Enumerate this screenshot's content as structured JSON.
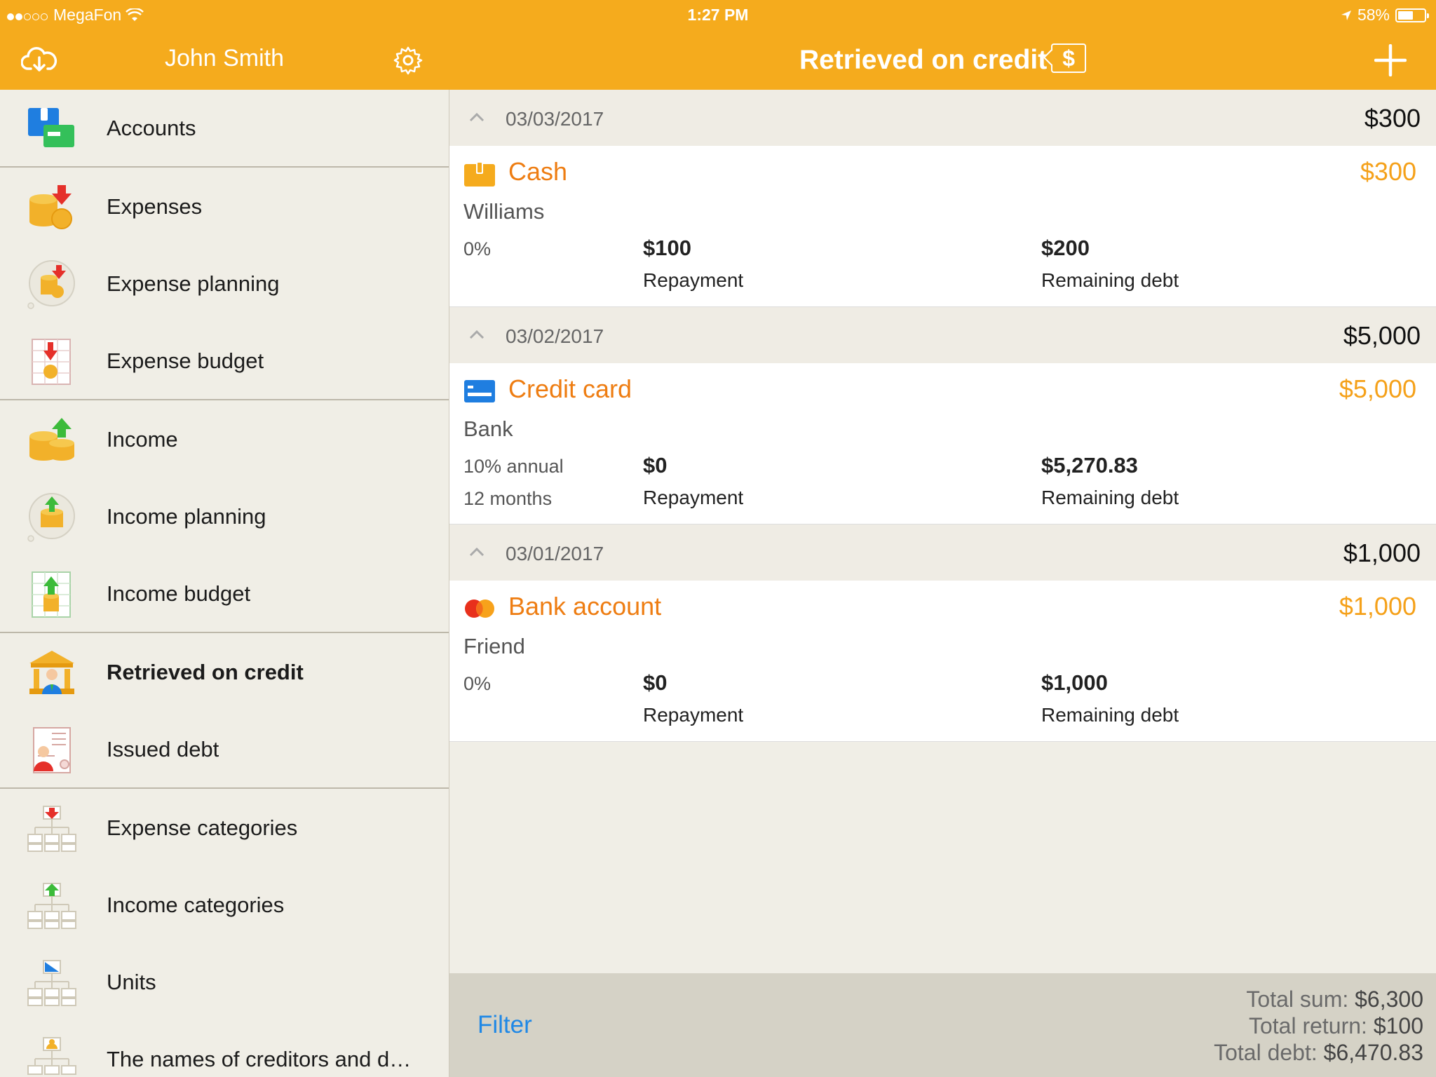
{
  "status_bar": {
    "carrier": "MegaFon",
    "time": "1:27 PM",
    "battery": "58%",
    "battery_level": 0.58
  },
  "sidebar_header": {
    "title": "John Smith",
    "left_icon": "cloud-download-icon",
    "right_icon": "gear-icon"
  },
  "sidebar": {
    "items": [
      {
        "label": "Accounts",
        "icon": "wallet-cards-icon"
      },
      {
        "label": "Expenses",
        "icon": "coins-down-icon"
      },
      {
        "label": "Expense planning",
        "icon": "coins-down-bubble-icon"
      },
      {
        "label": "Expense budget",
        "icon": "budget-down-icon"
      },
      {
        "label": "Income",
        "icon": "coins-up-icon"
      },
      {
        "label": "Income planning",
        "icon": "coins-up-bubble-icon"
      },
      {
        "label": "Income budget",
        "icon": "budget-up-icon"
      },
      {
        "label": "Retrieved on credit",
        "icon": "bank-icon"
      },
      {
        "label": "Issued debt",
        "icon": "contract-icon"
      },
      {
        "label": "Expense categories",
        "icon": "tree-down-icon"
      },
      {
        "label": "Income categories",
        "icon": "tree-up-icon"
      },
      {
        "label": "Units",
        "icon": "tree-ruler-icon"
      },
      {
        "label": "The names of creditors and d…",
        "icon": "tree-person-icon"
      }
    ]
  },
  "main_header": {
    "title": "Retrieved on credit",
    "currency_tag": "$",
    "add_icon": "plus-icon"
  },
  "groups": [
    {
      "date": "03/03/2017",
      "total": "$300",
      "entry": {
        "account": "Cash",
        "account_icon": "wallet-icon",
        "amount": "$300",
        "party": "Williams",
        "rate": "0%",
        "term": "",
        "repayment_value": "$100",
        "repayment_label": "Repayment",
        "debt_value": "$200",
        "debt_label": "Remaining debt"
      }
    },
    {
      "date": "03/02/2017",
      "total": "$5,000",
      "entry": {
        "account": "Credit card",
        "account_icon": "credit-card-icon",
        "amount": "$5,000",
        "party": "Bank",
        "rate": "10% annual",
        "term": "12 months",
        "repayment_value": "$0",
        "repayment_label": "Repayment",
        "debt_value": "$5,270.83",
        "debt_label": "Remaining debt"
      }
    },
    {
      "date": "03/01/2017",
      "total": "$1,000",
      "entry": {
        "account": "Bank account",
        "account_icon": "mastercard-icon",
        "amount": "$1,000",
        "party": "Friend",
        "rate": "0%",
        "term": "",
        "repayment_value": "$0",
        "repayment_label": "Repayment",
        "debt_value": "$1,000",
        "debt_label": "Remaining debt"
      }
    }
  ],
  "footer": {
    "filter_label": "Filter",
    "total_sum_label": "Total sum:",
    "total_sum_value": "$6,300",
    "total_return_label": "Total return:",
    "total_return_value": "$100",
    "total_debt_label": "Total debt:",
    "total_debt_value": "$6,470.83"
  },
  "colors": {
    "header": "#f5ab1d",
    "account_name": "#ee7d12",
    "account_amount": "#f5a11a",
    "filter": "#1f88e6"
  }
}
